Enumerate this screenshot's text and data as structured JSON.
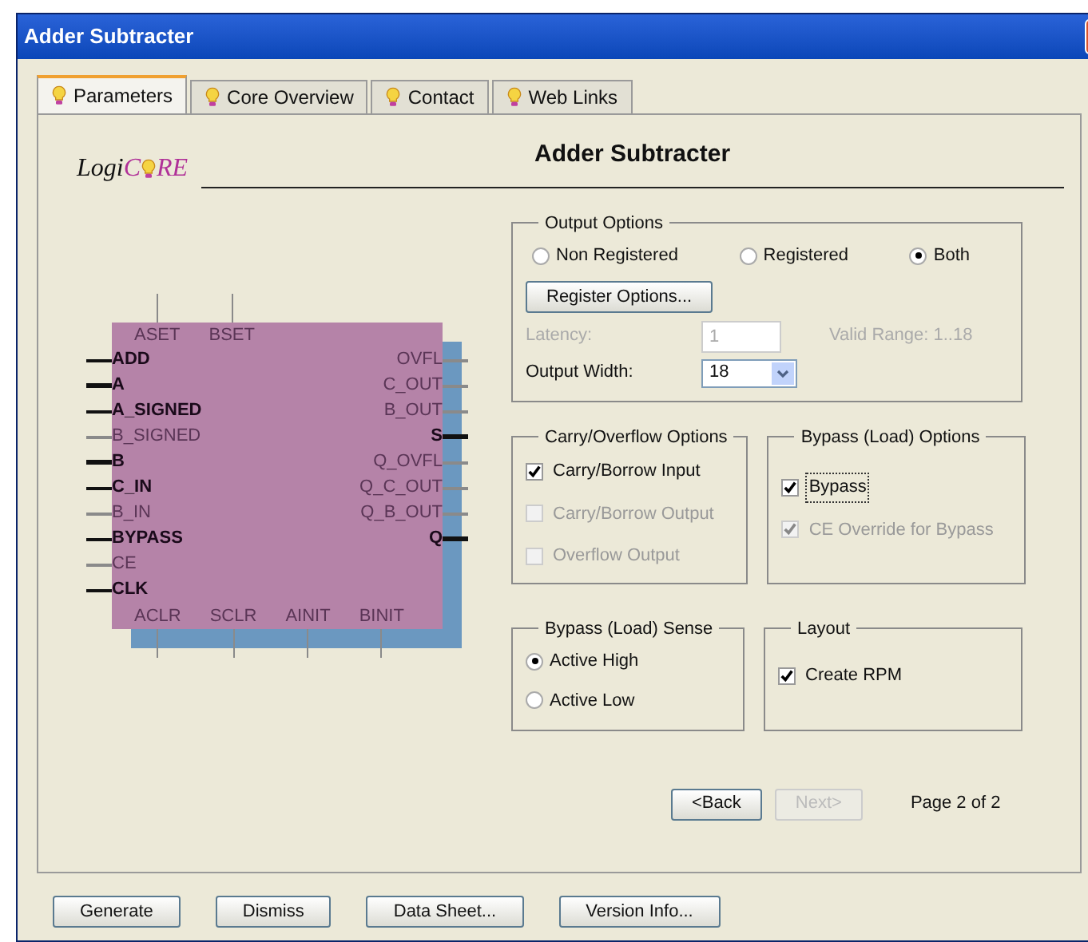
{
  "window": {
    "title": "Adder Subtracter"
  },
  "tabs": [
    {
      "label": "Parameters",
      "selected": true
    },
    {
      "label": "Core Overview",
      "selected": false
    },
    {
      "label": "Contact",
      "selected": false
    },
    {
      "label": "Web Links",
      "selected": false
    }
  ],
  "logo": {
    "start": "Logi",
    "mid": "C",
    "end": "RE"
  },
  "heading": "Adder Subtracter",
  "schematic": {
    "top_pins": [
      {
        "label": "ASET",
        "enabled": false
      },
      {
        "label": "BSET",
        "enabled": false
      }
    ],
    "left_pins": [
      {
        "label": "ADD",
        "enabled": true,
        "bus": false
      },
      {
        "label": "A",
        "enabled": true,
        "bus": true
      },
      {
        "label": "A_SIGNED",
        "enabled": true,
        "bus": false
      },
      {
        "label": "B_SIGNED",
        "enabled": false,
        "bus": false
      },
      {
        "label": "B",
        "enabled": true,
        "bus": true
      },
      {
        "label": "C_IN",
        "enabled": true,
        "bus": false
      },
      {
        "label": "B_IN",
        "enabled": false,
        "bus": false
      },
      {
        "label": "BYPASS",
        "enabled": true,
        "bus": false
      },
      {
        "label": "CE",
        "enabled": false,
        "bus": false
      },
      {
        "label": "CLK",
        "enabled": true,
        "bus": false
      }
    ],
    "right_pins": [
      {
        "label": "OVFL",
        "enabled": false,
        "bus": false
      },
      {
        "label": "C_OUT",
        "enabled": false,
        "bus": false
      },
      {
        "label": "B_OUT",
        "enabled": false,
        "bus": false
      },
      {
        "label": "S",
        "enabled": true,
        "bus": true
      },
      {
        "label": "Q_OVFL",
        "enabled": false,
        "bus": false
      },
      {
        "label": "Q_C_OUT",
        "enabled": false,
        "bus": false
      },
      {
        "label": "Q_B_OUT",
        "enabled": false,
        "bus": false
      },
      {
        "label": "Q",
        "enabled": true,
        "bus": true
      }
    ],
    "bottom_pins": [
      {
        "label": "ACLR",
        "enabled": false
      },
      {
        "label": "SCLR",
        "enabled": false
      },
      {
        "label": "AINIT",
        "enabled": false
      },
      {
        "label": "BINIT",
        "enabled": false
      }
    ]
  },
  "output_options": {
    "title": "Output Options",
    "radios": [
      {
        "label": "Non Registered",
        "selected": false
      },
      {
        "label": "Registered",
        "selected": false
      },
      {
        "label": "Both",
        "selected": true
      }
    ],
    "register_button": "Register Options...",
    "latency": {
      "label": "Latency:",
      "value": "1",
      "disabled": true
    },
    "valid_range": "Valid Range: 1..18",
    "output_width": {
      "label": "Output Width:",
      "value": "18"
    }
  },
  "carry_overflow": {
    "title": "Carry/Overflow Options",
    "items": [
      {
        "label": "Carry/Borrow Input",
        "checked": true,
        "disabled": false,
        "focused": false
      },
      {
        "label": "Carry/Borrow Output",
        "checked": false,
        "disabled": true,
        "focused": false
      },
      {
        "label": "Overflow Output",
        "checked": false,
        "disabled": true,
        "focused": false
      }
    ]
  },
  "bypass_options": {
    "title": "Bypass (Load) Options",
    "items": [
      {
        "label": "Bypass",
        "checked": true,
        "disabled": false,
        "focused": true
      },
      {
        "label": "CE Override for Bypass",
        "checked": true,
        "disabled": true,
        "focused": false
      }
    ]
  },
  "bypass_sense": {
    "title": "Bypass (Load) Sense",
    "radios": [
      {
        "label": "Active High",
        "selected": true
      },
      {
        "label": "Active Low",
        "selected": false
      }
    ]
  },
  "layout": {
    "title": "Layout",
    "items": [
      {
        "label": "Create RPM",
        "checked": true,
        "disabled": false,
        "focused": false
      }
    ]
  },
  "navigation": {
    "back": {
      "label": "<Back",
      "disabled": false
    },
    "next": {
      "label": "Next>",
      "disabled": true
    },
    "page": "Page 2 of 2"
  },
  "footer_buttons": [
    "Generate",
    "Dismiss",
    "Data Sheet...",
    "Version Info..."
  ]
}
